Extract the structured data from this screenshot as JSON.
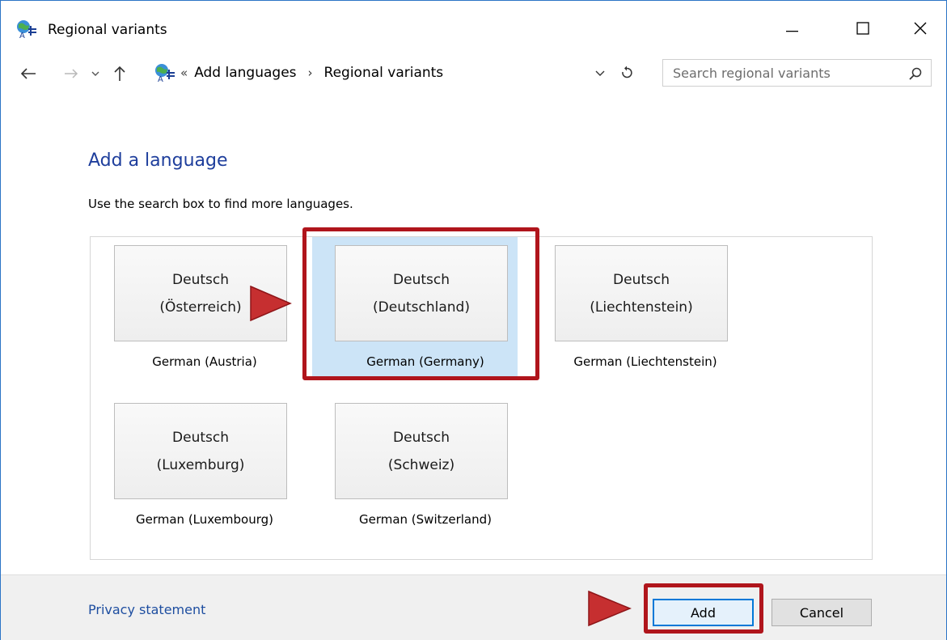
{
  "window": {
    "title": "Regional variants",
    "icon": "language-globe-icon"
  },
  "nav": {
    "breadcrumb": [
      "Add languages",
      "Regional variants"
    ],
    "search_placeholder": "Search regional variants"
  },
  "main": {
    "heading": "Add a language",
    "instruction": "Use the search box to find more languages."
  },
  "variants": [
    {
      "line1": "Deutsch",
      "line2": "(Österreich)",
      "caption": "German (Austria)",
      "selected": false
    },
    {
      "line1": "Deutsch",
      "line2": "(Deutschland)",
      "caption": "German (Germany)",
      "selected": true
    },
    {
      "line1": "Deutsch",
      "line2": "(Liechtenstein)",
      "caption": "German (Liechtenstein)",
      "selected": false
    },
    {
      "line1": "Deutsch",
      "line2": "(Luxemburg)",
      "caption": "German (Luxembourg)",
      "selected": false
    },
    {
      "line1": "Deutsch",
      "line2": "(Schweiz)",
      "caption": "German (Switzerland)",
      "selected": false
    }
  ],
  "footer": {
    "privacy_label": "Privacy statement",
    "add_label": "Add",
    "cancel_label": "Cancel"
  },
  "colors": {
    "highlight": "#b0151c",
    "heading": "#1e3e9c",
    "selected": "#cce4f7",
    "link": "#1e4ea0"
  }
}
